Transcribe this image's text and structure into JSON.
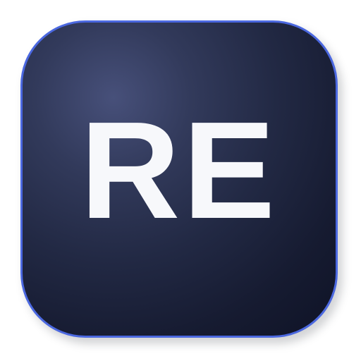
{
  "icon": {
    "label": "RE",
    "label_color": "#f7f8fb",
    "border_color": "#4b68e0",
    "background_colors": [
      "#47507a",
      "#222944",
      "#0f1326"
    ]
  }
}
